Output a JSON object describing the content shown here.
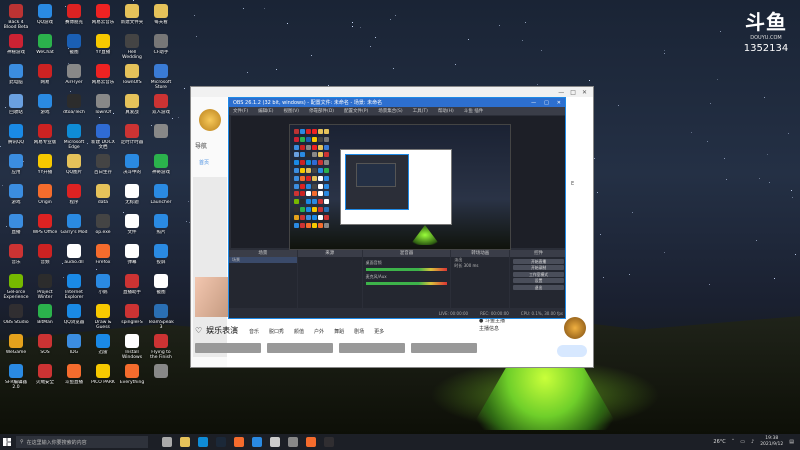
{
  "watermark": {
    "brand": "斗鱼",
    "url": "DOUYU.COM",
    "room_id": "1352134"
  },
  "desktop_icons": [
    {
      "label": "Back 4 Blood Beta",
      "color": "#b33"
    },
    {
      "label": "QQ游戏",
      "color": "#2a8ae2"
    },
    {
      "label": "赛博朋克",
      "color": "#d22"
    },
    {
      "label": "网易云音乐",
      "color": "#e22"
    },
    {
      "label": "新建文件夹",
      "color": "#e5c25a"
    },
    {
      "label": "每天看",
      "color": "#e5c25a"
    },
    {
      "label": "神秘游戏",
      "color": "#c23"
    },
    {
      "label": "WeChat",
      "color": "#2bb24c"
    },
    {
      "label": "截图",
      "color": "#1a5fb4"
    },
    {
      "label": "YY直播",
      "color": "#f7c900"
    },
    {
      "label": "Hell Wedding",
      "color": "#444"
    },
    {
      "label": "CF助手",
      "color": "#777"
    },
    {
      "label": "此电脑",
      "color": "#3b8de0"
    },
    {
      "label": "网易",
      "color": "#c22"
    },
    {
      "label": "AirFlyer",
      "color": "#888"
    },
    {
      "label": "网易云音乐",
      "color": "#e22"
    },
    {
      "label": "TownOfS",
      "color": "#e5c25a"
    },
    {
      "label": "Microsoft Store",
      "color": "#3a7bd5"
    },
    {
      "label": "回收站",
      "color": "#6aa0e0"
    },
    {
      "label": "游戏",
      "color": "#2a8ae2"
    },
    {
      "label": "dtoa/Tech",
      "color": "#2c2c2c"
    },
    {
      "label": "TownOf",
      "color": "#888"
    },
    {
      "label": "真爱战",
      "color": "#e5c25a"
    },
    {
      "label": "双人游戏",
      "color": "#c33"
    },
    {
      "label": "腾讯QQ",
      "color": "#1a8ae6"
    },
    {
      "label": "网易专业版",
      "color": "#c22"
    },
    {
      "label": "Microsoft Edge",
      "color": "#0f8cd6"
    },
    {
      "label": "新建 DOCX 文档",
      "color": "#2f6bd4"
    },
    {
      "label": "定时计时器",
      "color": "#c33"
    },
    {
      "label": "",
      "color": "#888"
    },
    {
      "label": "应用",
      "color": "#3b8de0"
    },
    {
      "label": "YY开播",
      "color": "#f7c900"
    },
    {
      "label": "QQ图片",
      "color": "#e5c25a"
    },
    {
      "label": "百日生存",
      "color": "#444"
    },
    {
      "label": "决斗中的",
      "color": "#2a8ae2"
    },
    {
      "label": "神奇游戏",
      "color": "#2bb24c"
    },
    {
      "label": "游戏",
      "color": "#3b8de0"
    },
    {
      "label": "Origin",
      "color": "#f56c2d"
    },
    {
      "label": "程序",
      "color": "#d22"
    },
    {
      "label": "data",
      "color": "#e5c25a"
    },
    {
      "label": "无标题",
      "color": "#fff"
    },
    {
      "label": "Launcher",
      "color": "#2a8ae2"
    },
    {
      "label": "直播",
      "color": "#3b8de0"
    },
    {
      "label": "WPS Office",
      "color": "#d22"
    },
    {
      "label": "Garry's Mod",
      "color": "#2a8ae2"
    },
    {
      "label": "op.exe",
      "color": "#444"
    },
    {
      "label": "文件",
      "color": "#fff"
    },
    {
      "label": "照片",
      "color": "#2a8ae2"
    },
    {
      "label": "音乐",
      "color": "#c33"
    },
    {
      "label": "音频",
      "color": "#c22"
    },
    {
      "label": "audio.dll",
      "color": "#fff"
    },
    {
      "label": "Firefox",
      "color": "#f56c2d"
    },
    {
      "label": "弹幕",
      "color": "#fff"
    },
    {
      "label": "投屏",
      "color": "#2a8ae2"
    },
    {
      "label": "GeForce Experience",
      "color": "#76b900"
    },
    {
      "label": "Project Winter",
      "color": "#2c2c2c"
    },
    {
      "label": "Internet Explorer",
      "color": "#1a8ae6"
    },
    {
      "label": "小鹅",
      "color": "#2a8ae2"
    },
    {
      "label": "直播助手",
      "color": "#c33"
    },
    {
      "label": "截图",
      "color": "#fff"
    },
    {
      "label": "OBS Studio",
      "color": "#302e31"
    },
    {
      "label": "BitMan",
      "color": "#2bb24c"
    },
    {
      "label": "QQ浏览器",
      "color": "#1a8ae6"
    },
    {
      "label": "Draw & Guess",
      "color": "#f7c900"
    },
    {
      "label": "spingleFS",
      "color": "#c33"
    },
    {
      "label": "TeamSpeak 3",
      "color": "#2a6fb4"
    },
    {
      "label": "WeGame",
      "color": "#e5a21c"
    },
    {
      "label": "SOS",
      "color": "#c33"
    },
    {
      "label": "IDG",
      "color": "#3b8de0"
    },
    {
      "label": "迅雷",
      "color": "#1a8ae6"
    },
    {
      "label": "Install Windows",
      "color": "#fff"
    },
    {
      "label": "Flying to the Finish",
      "color": "#c33"
    },
    {
      "label": "SFR编辑器 2.0",
      "color": "#2a8ae2"
    },
    {
      "label": "火绒安全",
      "color": "#c33"
    },
    {
      "label": "斗鱼直播",
      "color": "#f56c2d"
    },
    {
      "label": "PICO PARK",
      "color": "#f7c900"
    },
    {
      "label": "Everything",
      "color": "#f56c2d"
    },
    {
      "label": "",
      "color": "#888"
    }
  ],
  "browser": {
    "nav_label": "导航",
    "nav_sub": "首页",
    "section_title": "娱乐表演",
    "section_tabs": [
      "音乐",
      "脱口秀",
      "颜值",
      "户外",
      "舞蹈",
      "剧场",
      "更多"
    ],
    "side_char": "E",
    "notes": [
      "● 斗鱼主播",
      "主播信息"
    ]
  },
  "obs": {
    "title": "OBS 26.1.2 (32 bit, windows) - 配置文件: 未命名 - 场景: 未命名",
    "menu": [
      "文件(F)",
      "编辑(E)",
      "视图(V)",
      "停靠部件(D)",
      "配置文件(P)",
      "场景集合(S)",
      "工具(T)",
      "帮助(H)",
      "斗鱼 插件"
    ],
    "docks": {
      "scenes": {
        "title": "场景",
        "items": [
          "场景"
        ]
      },
      "sources": {
        "title": "来源",
        "items": []
      },
      "mixer": {
        "title": "混音器",
        "channels": [
          {
            "name": "桌面音频",
            "level": 0.8
          },
          {
            "name": "麦克风/Aux",
            "level": 0.6
          }
        ]
      },
      "transitions": {
        "title": "转场动画",
        "fade": "淡出",
        "duration_label": "时长",
        "duration": "300 ms"
      },
      "controls": {
        "title": "控件",
        "buttons": [
          "开始直播",
          "开始录制",
          "工作室模式",
          "设置",
          "退出"
        ]
      }
    },
    "status": [
      "LIVE: 00:00:00",
      "REC: 00:00:00",
      "CPU: 0.1%, 30.00 fps"
    ]
  },
  "taskbar": {
    "search_placeholder": "在这里输入你要搜索的内容",
    "apps": [
      {
        "name": "task-view",
        "color": "#aaa"
      },
      {
        "name": "file-explorer",
        "color": "#e5c25a"
      },
      {
        "name": "edge",
        "color": "#0f8cd6"
      },
      {
        "name": "steam",
        "color": "#1b2838"
      },
      {
        "name": "firefox",
        "color": "#f56c2d"
      },
      {
        "name": "mail",
        "color": "#2a8ae2"
      },
      {
        "name": "plane",
        "color": "#ccc"
      },
      {
        "name": "camera",
        "color": "#888"
      },
      {
        "name": "douyu",
        "color": "#f56c2d"
      },
      {
        "name": "obs",
        "color": "#302e31"
      }
    ],
    "weather": "26°C",
    "time": "19:38",
    "date": "2021/9/12"
  }
}
